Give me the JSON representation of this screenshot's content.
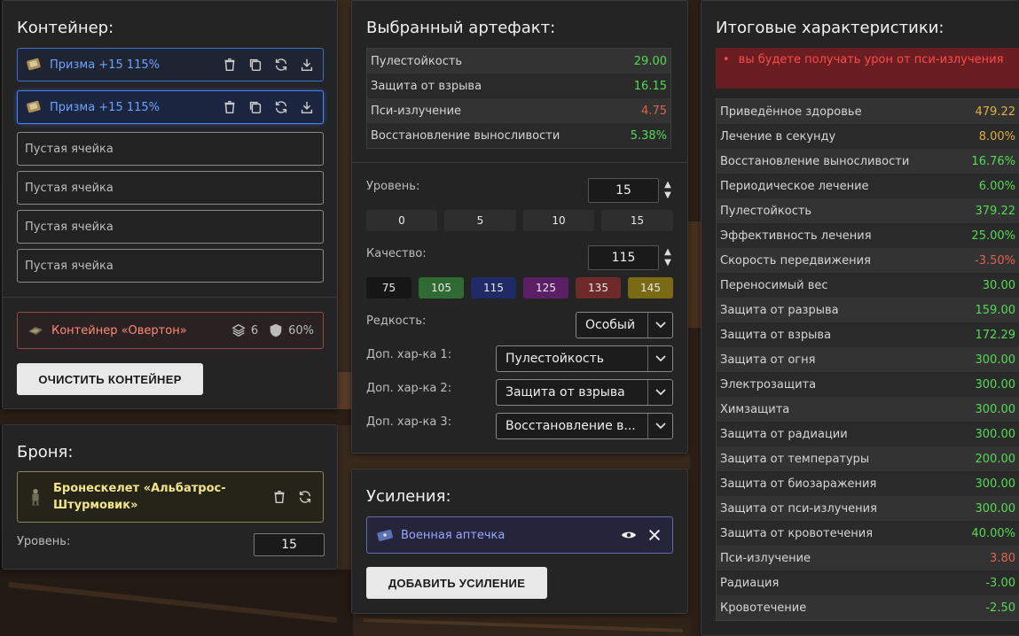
{
  "container": {
    "title": "Контейнер:",
    "slots": [
      {
        "name": "Призма +15 115%"
      },
      {
        "name": "Призма +15 115%"
      },
      {
        "empty": "Пустая ячейка"
      },
      {
        "empty": "Пустая ячейка"
      },
      {
        "empty": "Пустая ячейка"
      },
      {
        "empty": "Пустая ячейка"
      }
    ],
    "box": {
      "name": "Контейнер «Овертон»",
      "slots": "6",
      "protection": "60%"
    },
    "clear_label": "ОЧИСТИТЬ КОНТЕЙНЕР"
  },
  "armor": {
    "title": "Броня:",
    "name": "Бронескелет «Альбатрос-Штурмовик»",
    "level_label": "Уровень:",
    "level": "15"
  },
  "artifact": {
    "title": "Выбранный артефакт:",
    "stats": [
      {
        "label": "Пулестойкость",
        "value": "29.00",
        "tone": "pos"
      },
      {
        "label": "Защита от взрыва",
        "value": "16.15",
        "tone": "pos"
      },
      {
        "label": "Пси-излучение",
        "value": "4.75",
        "tone": "neg"
      },
      {
        "label": "Восстановление выносливости",
        "value": "5.38%",
        "tone": "pos"
      }
    ],
    "level_label": "Уровень:",
    "level": "15",
    "level_presets": [
      "0",
      "5",
      "10",
      "15"
    ],
    "quality_label": "Качество:",
    "quality": "115",
    "quality_presets": [
      {
        "v": "75",
        "color": "#161616"
      },
      {
        "v": "105",
        "color": "#2e6a32"
      },
      {
        "v": "115",
        "color": "#1f2a66"
      },
      {
        "v": "125",
        "color": "#5a1f66"
      },
      {
        "v": "135",
        "color": "#6e2a28"
      },
      {
        "v": "145",
        "color": "#7a6a14"
      }
    ],
    "rarity_label": "Редкость:",
    "rarity": "Особый",
    "extra1_label": "Доп. хар-ка 1:",
    "extra1": "Пулестойкость",
    "extra2_label": "Доп. хар-ка 2:",
    "extra2": "Защита от взрыва",
    "extra3_label": "Доп. хар-ка 3:",
    "extra3": "Восстановление в..."
  },
  "boosts": {
    "title": "Усиления:",
    "item": "Военная аптечка",
    "add_label": "ДОБАВИТЬ УСИЛЕНИЕ"
  },
  "results": {
    "title": "Итоговые характеристики:",
    "warning_bullet": "•",
    "warning": "вы будете получать урон от пси-излучения",
    "stats": [
      {
        "label": "Приведённое здоровье",
        "value": "479.22",
        "tone": "warn"
      },
      {
        "label": "Лечение в секунду",
        "value": "8.00%",
        "tone": "warn"
      },
      {
        "label": "Восстановление выносливости",
        "value": "16.76%",
        "tone": "pos"
      },
      {
        "label": "Периодическое лечение",
        "value": "6.00%",
        "tone": "pos"
      },
      {
        "label": "Пулестойкость",
        "value": "379.22",
        "tone": "pos"
      },
      {
        "label": "Эффективность лечения",
        "value": "25.00%",
        "tone": "pos"
      },
      {
        "label": "Скорость передвижения",
        "value": "-3.50%",
        "tone": "neg"
      },
      {
        "label": "Переносимый вес",
        "value": "30.00",
        "tone": "pos"
      },
      {
        "label": "Защита от разрыва",
        "value": "159.00",
        "tone": "pos"
      },
      {
        "label": "Защита от взрыва",
        "value": "172.29",
        "tone": "pos"
      },
      {
        "label": "Защита от огня",
        "value": "300.00",
        "tone": "pos"
      },
      {
        "label": "Электрозащита",
        "value": "300.00",
        "tone": "pos"
      },
      {
        "label": "Химзащита",
        "value": "300.00",
        "tone": "pos"
      },
      {
        "label": "Защита от радиации",
        "value": "300.00",
        "tone": "pos"
      },
      {
        "label": "Защита от температуры",
        "value": "200.00",
        "tone": "pos"
      },
      {
        "label": "Защита от биозаражения",
        "value": "300.00",
        "tone": "pos"
      },
      {
        "label": "Защита от пси-излучения",
        "value": "300.00",
        "tone": "pos"
      },
      {
        "label": "Защита от кровотечения",
        "value": "40.00%",
        "tone": "pos"
      },
      {
        "label": "Пси-излучение",
        "value": "3.80",
        "tone": "neg"
      },
      {
        "label": "Радиация",
        "value": "-3.00",
        "tone": "pos"
      },
      {
        "label": "Кровотечение",
        "value": "-2.50",
        "tone": "pos"
      }
    ]
  }
}
